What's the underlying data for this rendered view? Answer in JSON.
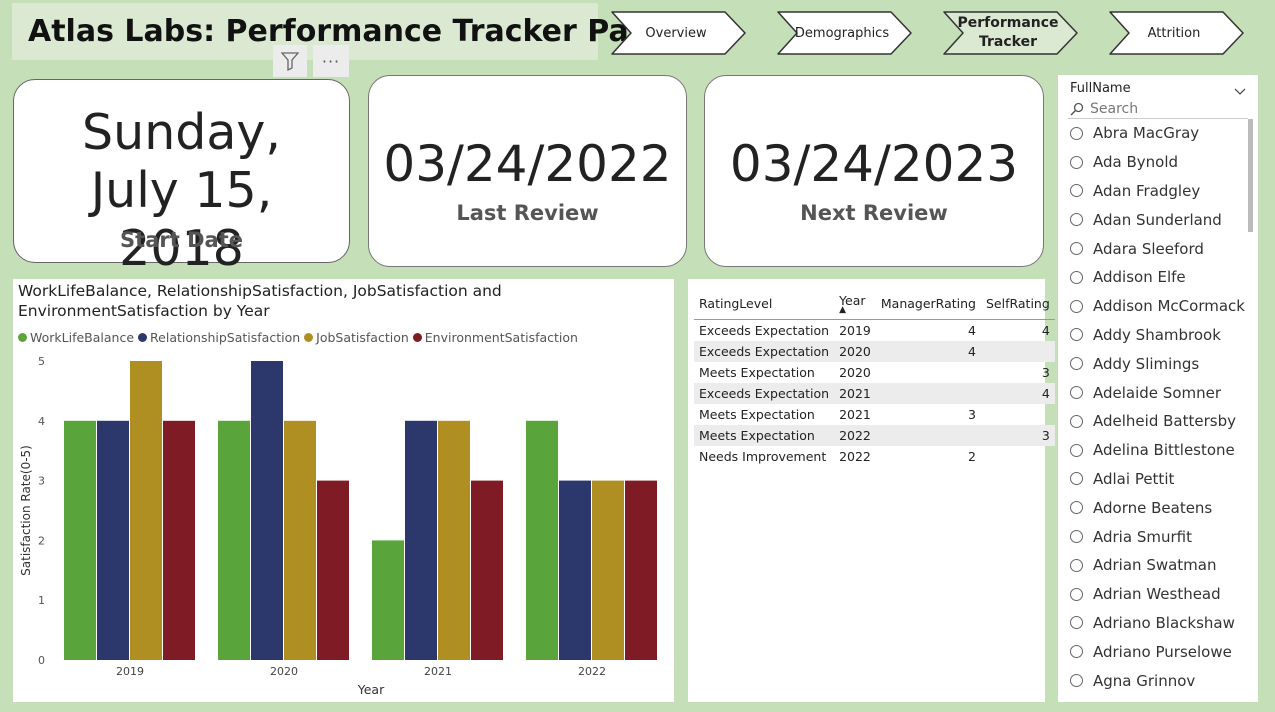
{
  "header": {
    "title": "Atlas Labs: Performance Tracker Page"
  },
  "nav": {
    "tabs": [
      {
        "label": "Overview",
        "active": false
      },
      {
        "label": "Demographics",
        "active": false
      },
      {
        "label": "Performance Tracker",
        "active": true
      },
      {
        "label": "Attrition",
        "active": false
      }
    ]
  },
  "toolbar": {
    "more_label": "···"
  },
  "cards": {
    "start": {
      "value": "Sunday, July 15, 2018",
      "label": "Start Date"
    },
    "last": {
      "value": "03/24/2022",
      "label": "Last Review"
    },
    "next": {
      "value": "03/24/2023",
      "label": "Next Review"
    }
  },
  "chart_data": {
    "type": "bar",
    "title": "WorkLifeBalance, RelationshipSatisfaction, JobSatisfaction and EnvironmentSatisfaction by Year",
    "xlabel": "Year",
    "ylabel": "Satisfaction Rate(0-5)",
    "categories": [
      "2019",
      "2020",
      "2021",
      "2022"
    ],
    "ylim": [
      0,
      5
    ],
    "yticks": [
      0,
      1,
      2,
      3,
      4,
      5
    ],
    "legend_position": "top-left",
    "grid": false,
    "series": [
      {
        "name": "WorkLifeBalance",
        "color": "#5aa53b",
        "values": [
          4,
          4,
          2,
          4
        ]
      },
      {
        "name": "RelationshipSatisfaction",
        "color": "#2c376b",
        "values": [
          4,
          5,
          4,
          3
        ]
      },
      {
        "name": "JobSatisfaction",
        "color": "#b08f22",
        "values": [
          5,
          4,
          4,
          3
        ]
      },
      {
        "name": "EnvironmentSatisfaction",
        "color": "#7f1b24",
        "values": [
          4,
          3,
          3,
          3
        ]
      }
    ]
  },
  "ratings_table": {
    "columns": [
      "RatingLevel",
      "Year",
      "ManagerRating",
      "SelfRating"
    ],
    "sort_indicator": "▲",
    "rows": [
      [
        "Exceeds Expectation",
        "2019",
        "4",
        "4"
      ],
      [
        "Exceeds Expectation",
        "2020",
        "4",
        ""
      ],
      [
        "Meets Expectation",
        "2020",
        "",
        "3"
      ],
      [
        "Exceeds Expectation",
        "2021",
        "",
        "4"
      ],
      [
        "Meets Expectation",
        "2021",
        "3",
        ""
      ],
      [
        "Meets Expectation",
        "2022",
        "",
        "3"
      ],
      [
        "Needs Improvement",
        "2022",
        "2",
        ""
      ]
    ]
  },
  "slicer": {
    "header": "FullName",
    "search_placeholder": "Search",
    "items": [
      "Abra MacGray",
      "Ada Bynold",
      "Adan Fradgley",
      "Adan Sunderland",
      "Adara Sleeford",
      "Addison Elfe",
      "Addison McCormack",
      "Addy Shambrook",
      "Addy Slimings",
      "Adelaide Somner",
      "Adelheid Battersby",
      "Adelina Bittlestone",
      "Adlai Pettit",
      "Adorne Beatens",
      "Adria Smurfit",
      "Adrian Swatman",
      "Adrian Westhead",
      "Adriano Blackshaw",
      "Adriano Purselowe",
      "Agna Grinnov"
    ]
  }
}
